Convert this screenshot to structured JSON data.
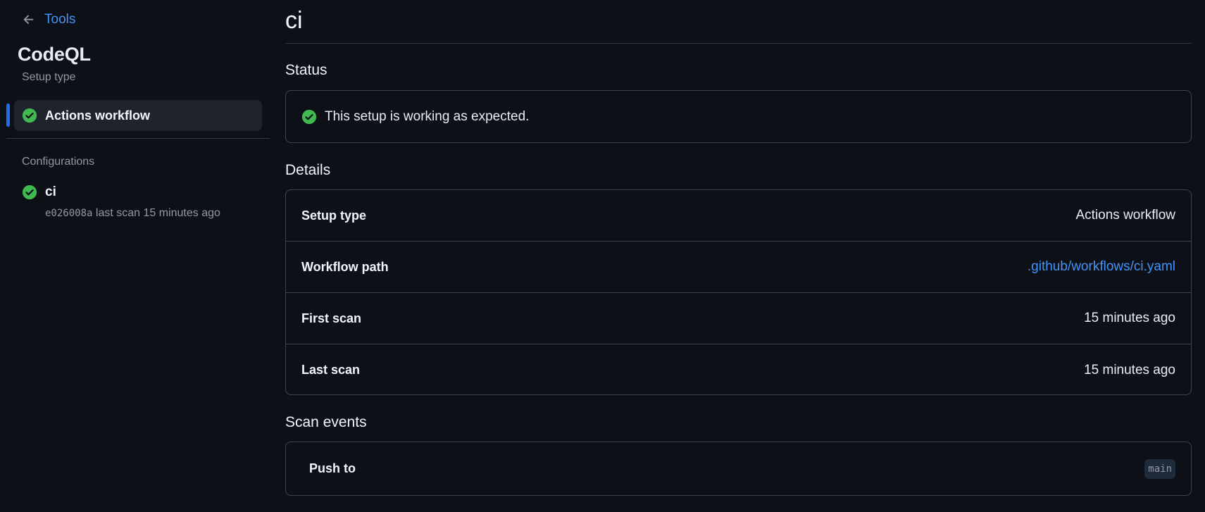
{
  "sidebar": {
    "back_label": "Tools",
    "tool_name": "CodeQL",
    "setup_type_label": "Setup type",
    "setup_item": {
      "label": "Actions workflow",
      "status": "success"
    },
    "configurations_label": "Configurations",
    "configurations": [
      {
        "name": "ci",
        "sha": "e026008a",
        "meta": "last scan 15 minutes ago",
        "status": "success"
      }
    ]
  },
  "main": {
    "title": "ci",
    "status": {
      "heading": "Status",
      "message": "This setup is working as expected."
    },
    "details": {
      "heading": "Details",
      "rows": [
        {
          "key": "Setup type",
          "value": "Actions workflow"
        },
        {
          "key": "Workflow path",
          "value": ".github/workflows/ci.yaml"
        },
        {
          "key": "First scan",
          "value": "15 minutes ago"
        },
        {
          "key": "Last scan",
          "value": "15 minutes ago"
        }
      ]
    },
    "scan_events": {
      "heading": "Scan events",
      "event_label": "Push to",
      "branch": "main"
    }
  },
  "colors": {
    "background": "#0d1117",
    "accent_link": "#4493f8",
    "success": "#3fb950",
    "active_indicator": "#1f6feb"
  },
  "icons": {
    "back": "arrow-left-icon",
    "success": "check-circle-fill-icon"
  }
}
